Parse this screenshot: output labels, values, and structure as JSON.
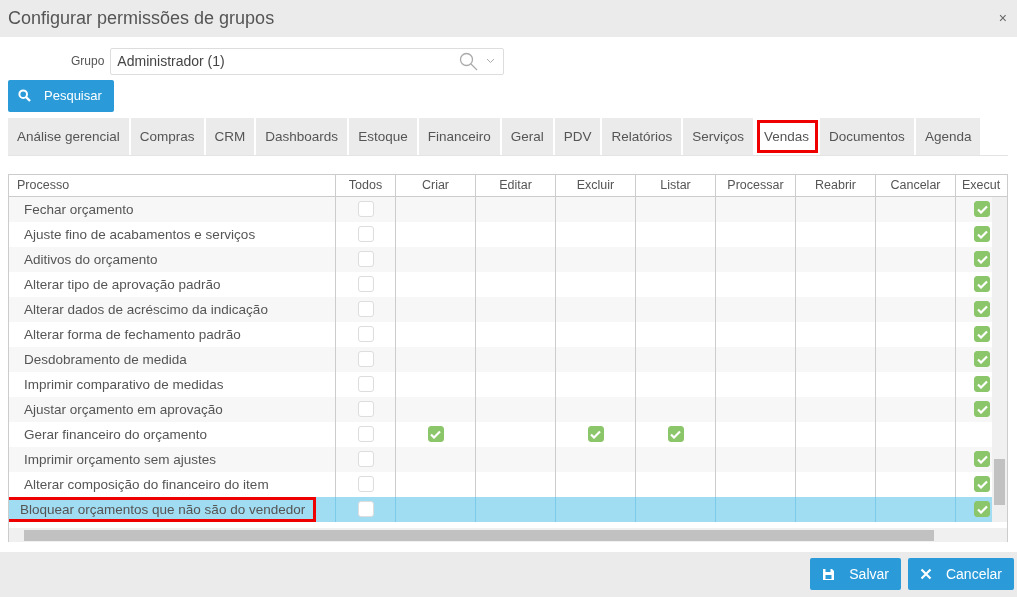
{
  "window": {
    "title": "Configurar permissões de grupos",
    "close": "×"
  },
  "group_field": {
    "label": "Grupo",
    "value": "Administrador (1)"
  },
  "search_button": {
    "label": "Pesquisar"
  },
  "tabs": [
    {
      "label": "Análise gerencial",
      "selected": false,
      "annotated": false
    },
    {
      "label": "Compras",
      "selected": false,
      "annotated": false
    },
    {
      "label": "CRM",
      "selected": false,
      "annotated": false
    },
    {
      "label": "Dashboards",
      "selected": false,
      "annotated": false
    },
    {
      "label": "Estoque",
      "selected": false,
      "annotated": false
    },
    {
      "label": "Financeiro",
      "selected": false,
      "annotated": false
    },
    {
      "label": "Geral",
      "selected": false,
      "annotated": false
    },
    {
      "label": "PDV",
      "selected": false,
      "annotated": false
    },
    {
      "label": "Relatórios",
      "selected": false,
      "annotated": false
    },
    {
      "label": "Serviços",
      "selected": false,
      "annotated": false
    },
    {
      "label": "Vendas",
      "selected": true,
      "annotated": true
    },
    {
      "label": "Documentos",
      "selected": false,
      "annotated": false
    },
    {
      "label": "Agenda",
      "selected": false,
      "annotated": false
    }
  ],
  "table": {
    "columns": [
      "Processo",
      "Todos",
      "Criar",
      "Editar",
      "Excluir",
      "Listar",
      "Processar",
      "Reabrir",
      "Cancelar",
      "Execut"
    ],
    "rows": [
      {
        "label": "Fechar orçamento",
        "selected": false,
        "annotated": false,
        "cells": [
          {
            "kind": "checkbox",
            "checked": false
          },
          {
            "kind": "empty"
          },
          {
            "kind": "empty"
          },
          {
            "kind": "empty"
          },
          {
            "kind": "empty"
          },
          {
            "kind": "empty"
          },
          {
            "kind": "empty"
          },
          {
            "kind": "empty"
          },
          {
            "kind": "checkbox",
            "checked": true
          }
        ]
      },
      {
        "label": "Ajuste fino de acabamentos e serviços",
        "selected": false,
        "annotated": false,
        "cells": [
          {
            "kind": "checkbox",
            "checked": false
          },
          {
            "kind": "empty"
          },
          {
            "kind": "empty"
          },
          {
            "kind": "empty"
          },
          {
            "kind": "empty"
          },
          {
            "kind": "empty"
          },
          {
            "kind": "empty"
          },
          {
            "kind": "empty"
          },
          {
            "kind": "checkbox",
            "checked": true
          }
        ]
      },
      {
        "label": "Aditivos do orçamento",
        "selected": false,
        "annotated": false,
        "cells": [
          {
            "kind": "checkbox",
            "checked": false
          },
          {
            "kind": "empty"
          },
          {
            "kind": "empty"
          },
          {
            "kind": "empty"
          },
          {
            "kind": "empty"
          },
          {
            "kind": "empty"
          },
          {
            "kind": "empty"
          },
          {
            "kind": "empty"
          },
          {
            "kind": "checkbox",
            "checked": true
          }
        ]
      },
      {
        "label": "Alterar tipo de aprovação padrão",
        "selected": false,
        "annotated": false,
        "cells": [
          {
            "kind": "checkbox",
            "checked": false
          },
          {
            "kind": "empty"
          },
          {
            "kind": "empty"
          },
          {
            "kind": "empty"
          },
          {
            "kind": "empty"
          },
          {
            "kind": "empty"
          },
          {
            "kind": "empty"
          },
          {
            "kind": "empty"
          },
          {
            "kind": "checkbox",
            "checked": true
          }
        ]
      },
      {
        "label": "Alterar dados de acréscimo da indicação",
        "selected": false,
        "annotated": false,
        "cells": [
          {
            "kind": "checkbox",
            "checked": false
          },
          {
            "kind": "empty"
          },
          {
            "kind": "empty"
          },
          {
            "kind": "empty"
          },
          {
            "kind": "empty"
          },
          {
            "kind": "empty"
          },
          {
            "kind": "empty"
          },
          {
            "kind": "empty"
          },
          {
            "kind": "checkbox",
            "checked": true
          }
        ]
      },
      {
        "label": "Alterar forma de fechamento padrão",
        "selected": false,
        "annotated": false,
        "cells": [
          {
            "kind": "checkbox",
            "checked": false
          },
          {
            "kind": "empty"
          },
          {
            "kind": "empty"
          },
          {
            "kind": "empty"
          },
          {
            "kind": "empty"
          },
          {
            "kind": "empty"
          },
          {
            "kind": "empty"
          },
          {
            "kind": "empty"
          },
          {
            "kind": "checkbox",
            "checked": true
          }
        ]
      },
      {
        "label": "Desdobramento de medida",
        "selected": false,
        "annotated": false,
        "cells": [
          {
            "kind": "checkbox",
            "checked": false
          },
          {
            "kind": "empty"
          },
          {
            "kind": "empty"
          },
          {
            "kind": "empty"
          },
          {
            "kind": "empty"
          },
          {
            "kind": "empty"
          },
          {
            "kind": "empty"
          },
          {
            "kind": "empty"
          },
          {
            "kind": "checkbox",
            "checked": true
          }
        ]
      },
      {
        "label": "Imprimir comparativo de medidas",
        "selected": false,
        "annotated": false,
        "cells": [
          {
            "kind": "checkbox",
            "checked": false
          },
          {
            "kind": "empty"
          },
          {
            "kind": "empty"
          },
          {
            "kind": "empty"
          },
          {
            "kind": "empty"
          },
          {
            "kind": "empty"
          },
          {
            "kind": "empty"
          },
          {
            "kind": "empty"
          },
          {
            "kind": "checkbox",
            "checked": true
          }
        ]
      },
      {
        "label": "Ajustar orçamento em aprovação",
        "selected": false,
        "annotated": false,
        "cells": [
          {
            "kind": "checkbox",
            "checked": false
          },
          {
            "kind": "empty"
          },
          {
            "kind": "empty"
          },
          {
            "kind": "empty"
          },
          {
            "kind": "empty"
          },
          {
            "kind": "empty"
          },
          {
            "kind": "empty"
          },
          {
            "kind": "empty"
          },
          {
            "kind": "checkbox",
            "checked": true
          }
        ]
      },
      {
        "label": "Gerar financeiro do orçamento",
        "selected": false,
        "annotated": false,
        "cells": [
          {
            "kind": "checkbox",
            "checked": false
          },
          {
            "kind": "checkbox",
            "checked": true
          },
          {
            "kind": "empty"
          },
          {
            "kind": "checkbox",
            "checked": true
          },
          {
            "kind": "checkbox",
            "checked": true
          },
          {
            "kind": "empty"
          },
          {
            "kind": "empty"
          },
          {
            "kind": "empty"
          },
          {
            "kind": "empty"
          }
        ]
      },
      {
        "label": "Imprimir orçamento sem ajustes",
        "selected": false,
        "annotated": false,
        "cells": [
          {
            "kind": "checkbox",
            "checked": false
          },
          {
            "kind": "empty"
          },
          {
            "kind": "empty"
          },
          {
            "kind": "empty"
          },
          {
            "kind": "empty"
          },
          {
            "kind": "empty"
          },
          {
            "kind": "empty"
          },
          {
            "kind": "empty"
          },
          {
            "kind": "checkbox",
            "checked": true
          }
        ]
      },
      {
        "label": "Alterar composição do financeiro do item",
        "selected": false,
        "annotated": false,
        "cells": [
          {
            "kind": "checkbox",
            "checked": false
          },
          {
            "kind": "empty"
          },
          {
            "kind": "empty"
          },
          {
            "kind": "empty"
          },
          {
            "kind": "empty"
          },
          {
            "kind": "empty"
          },
          {
            "kind": "empty"
          },
          {
            "kind": "empty"
          },
          {
            "kind": "checkbox",
            "checked": true
          }
        ]
      },
      {
        "label": "Bloquear orçamentos que não são do vendedor",
        "selected": true,
        "annotated": true,
        "cells": [
          {
            "kind": "checkbox",
            "checked": false
          },
          {
            "kind": "empty"
          },
          {
            "kind": "empty"
          },
          {
            "kind": "empty"
          },
          {
            "kind": "empty"
          },
          {
            "kind": "empty"
          },
          {
            "kind": "empty"
          },
          {
            "kind": "empty"
          },
          {
            "kind": "checkbox",
            "checked": true
          }
        ]
      }
    ]
  },
  "footer_buttons": [
    {
      "kind": "save",
      "label": "Salvar"
    },
    {
      "kind": "cancel",
      "label": "Cancelar"
    }
  ]
}
